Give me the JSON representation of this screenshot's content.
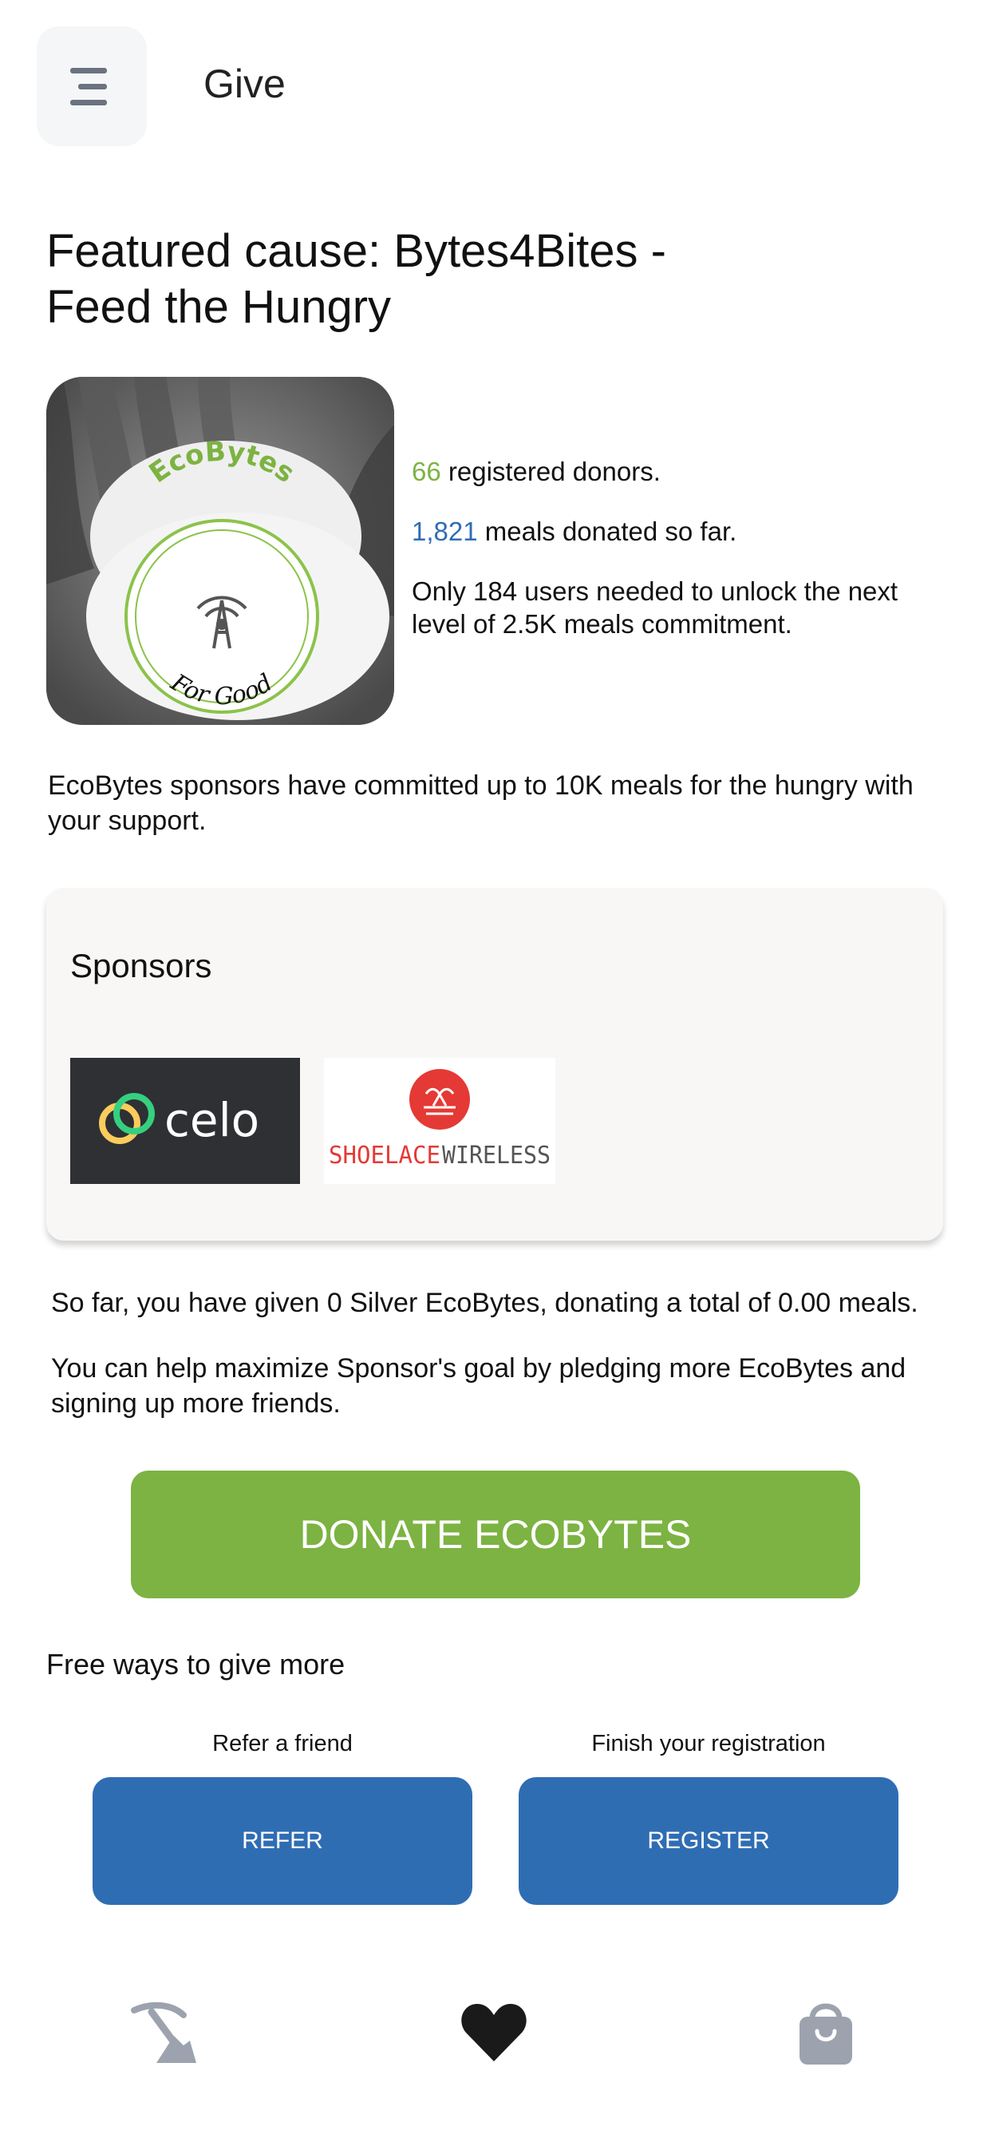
{
  "header": {
    "title": "Give",
    "menu_icon": "hamburger-icon"
  },
  "cause": {
    "title": "Featured cause: Bytes4Bites - Feed the Hungry",
    "image_text_top": "EcoBytes",
    "image_text_bottom": "For Good",
    "donors_count": "66",
    "donors_text": " registered donors.",
    "meals_count": "1,821",
    "meals_text": " meals donated so far.",
    "unlock_text": "Only 184 users needed to unlock the next level of 2.5K meals commitment."
  },
  "committed_text": "EcoBytes sponsors have committed up to 10K meals for the hungry with your support.",
  "sponsors": {
    "title": "Sponsors",
    "logos": [
      {
        "name": "celo",
        "text": "celo"
      },
      {
        "name": "shoelace",
        "text_a": "SHOELACE",
        "text_b": "WIRELESS"
      }
    ]
  },
  "given_text": "So far, you have given 0 Silver EcoBytes, donating a total of 0.00 meals.",
  "help_text": "You can help maximize Sponsor's goal by pledging more EcoBytes and signing up more friends.",
  "donate_label": "DONATE ECOBYTES",
  "free_ways": {
    "title": "Free ways to give more",
    "refer_label": "Refer a friend",
    "refer_button": "REFER",
    "register_label": "Finish your registration",
    "register_button": "REGISTER"
  },
  "bottom_nav": [
    {
      "icon": "pickaxe-mine-icon"
    },
    {
      "icon": "heart-icon"
    },
    {
      "icon": "shopping-bag-icon"
    }
  ],
  "colors": {
    "accent_green": "#7cb342",
    "accent_blue": "#2f6db3",
    "shoelace_red": "#e53935"
  }
}
